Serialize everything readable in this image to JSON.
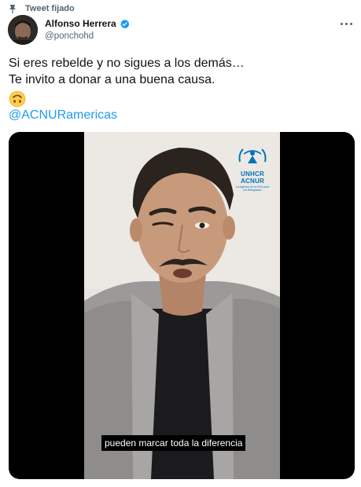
{
  "pinned": {
    "label": "Tweet fijado",
    "icon": "pin-icon"
  },
  "author": {
    "name": "Alfonso Herrera",
    "handle": "@ponchohd",
    "verified_icon": "verified-badge-icon",
    "verified_color": "#1d9bf0"
  },
  "more_icon": "more-options-icon",
  "tweet": {
    "lines": [
      "Si eres rebelde y no sigues a los demás…",
      "Te invito a donar a una buena causa."
    ],
    "emoji": "upside-down-face-icon",
    "mention": "@ACNURamericas",
    "mention_color": "#1d9bf0"
  },
  "media": {
    "logo": {
      "line1": "UNHCR",
      "line2": "ACNUR",
      "tagline": "La Agencia de la ONU para los Refugiados",
      "color": "#0072bc"
    },
    "subtitle": "pueden marcar toda la diferencia"
  }
}
